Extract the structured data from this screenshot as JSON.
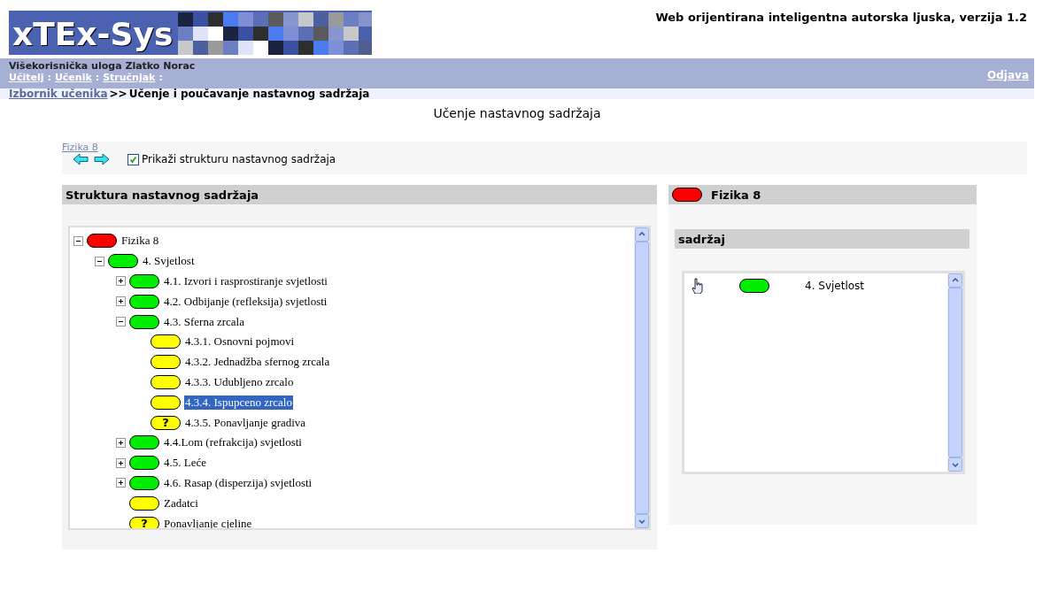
{
  "header": {
    "logo": "xTEx-Sys",
    "tagline": "Web orijentirana inteligentna autorska ljuska, verzija 1.2"
  },
  "user_bar": {
    "role_label": "Višekorisnička uloga",
    "user": "Zlatko Norac",
    "roles": [
      "Učitelj",
      "Učenik",
      "Stručnjak"
    ],
    "separator": ":",
    "logout": "Odjava"
  },
  "breadcrumb": {
    "link": "Izbornik učenika",
    "separator": ">>",
    "current": "Učenje i poučavanje nastavnog sadržaja"
  },
  "page_title": "Učenje nastavnog sadržaja",
  "nav": {
    "link": "Fizika 8",
    "show_structure": {
      "label": "Prikaži strukturu nastavnog sadržaja",
      "checked": true
    }
  },
  "structure_panel": {
    "title": "Struktura nastavnog sadržaja",
    "tree": [
      {
        "label": "Fizika 8",
        "kind": "plain",
        "color": "#ff0000",
        "expanded": true,
        "selected": false,
        "children": [
          {
            "label": "4. Svjetlost",
            "kind": "plain",
            "color": "#00ee00",
            "expanded": true,
            "selected": false,
            "children": [
              {
                "label": "4.1. Izvori i rasprostiranje svjetlosti",
                "kind": "plain",
                "color": "#00ee00",
                "expanded": false,
                "selected": false
              },
              {
                "label": "4.2. Odbijanje (refleksija) svjetlosti",
                "kind": "plain",
                "color": "#00ee00",
                "expanded": false,
                "selected": false
              },
              {
                "label": "4.3. Sferna zrcala",
                "kind": "plain",
                "color": "#00ee00",
                "expanded": true,
                "selected": false,
                "children": [
                  {
                    "label": "4.3.1. Osnovni pojmovi",
                    "kind": "plain",
                    "color": "#ffff00",
                    "selected": false
                  },
                  {
                    "label": "4.3.2. Jednadžba sfernog zrcala",
                    "kind": "plain",
                    "color": "#ffff00",
                    "selected": false
                  },
                  {
                    "label": "4.3.3. Udubljeno zrcalo",
                    "kind": "plain",
                    "color": "#ffff00",
                    "selected": false
                  },
                  {
                    "label": "4.3.4. Ispupceno zrcalo",
                    "kind": "plain",
                    "color": "#ffff00",
                    "selected": true
                  },
                  {
                    "label": "4.3.5. Ponavljanje gradiva",
                    "kind": "quiz",
                    "mark": "?",
                    "color": "#ffff00",
                    "selected": false
                  }
                ]
              },
              {
                "label": "4.4.Lom (refrakcija) svjetlosti",
                "kind": "plain",
                "color": "#00ee00",
                "expanded": false,
                "selected": false
              },
              {
                "label": "4.5. Leće",
                "kind": "plain",
                "color": "#00ee00",
                "expanded": false,
                "selected": false
              },
              {
                "label": "4.6. Rasap (disperzija) svjetlosti",
                "kind": "plain",
                "color": "#00ee00",
                "expanded": false,
                "selected": false
              },
              {
                "label": "Zadatci",
                "kind": "plain",
                "color": "#ffff00",
                "selected": false
              },
              {
                "label": "Ponavljanje cjeline",
                "kind": "quiz",
                "mark": "?",
                "color": "#ffff00",
                "selected": false
              }
            ]
          }
        ]
      }
    ]
  },
  "content_panel": {
    "title": "Fizika 8",
    "color": "#ff0000",
    "section": "sadržaj",
    "items": [
      {
        "label": "4. Svjetlost",
        "color": "#00ee00"
      }
    ]
  }
}
